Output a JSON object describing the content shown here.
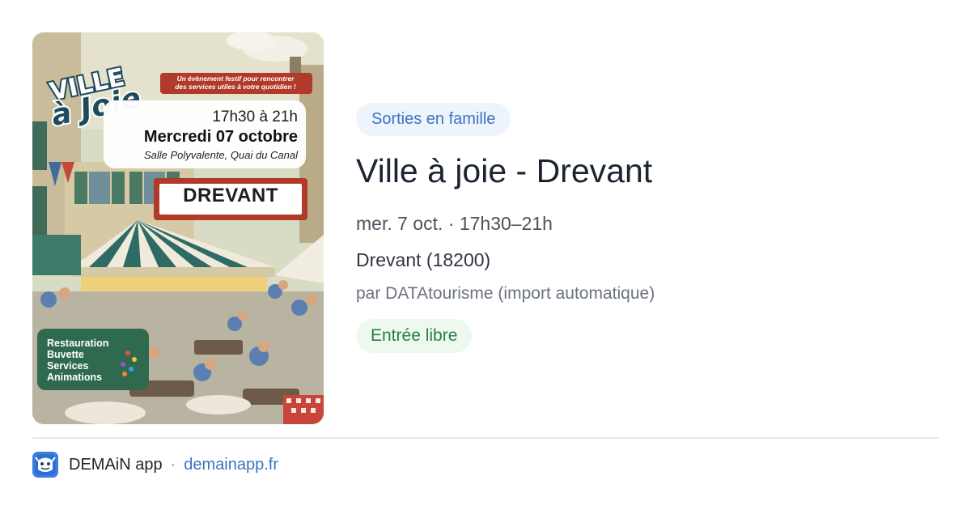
{
  "poster": {
    "brand_line1": "VILLE",
    "brand_line2": "à Joie",
    "tagline_line1": "Un évènement festif pour rencontrer",
    "tagline_line2": "des services utiles à votre quotidien !",
    "time": "17h30 à 21h",
    "date": "Mercredi 07 octobre",
    "venue": "Salle Polyvalente, Quai du Canal",
    "town": "DREVANT",
    "features": [
      "Restauration",
      "Buvette",
      "Services",
      "Animations"
    ]
  },
  "event": {
    "category": "Sorties en famille",
    "title": "Ville à joie - Drevant",
    "datetime": "mer. 7 oct. · 17h30–21h",
    "location": "Drevant (18200)",
    "source": "par DATAtourisme (import automatique)",
    "price": "Entrée libre"
  },
  "footer": {
    "app_name": "DEMAiN app",
    "separator": "·",
    "link": "demainapp.fr",
    "icon": "demain-app-icon"
  },
  "colors": {
    "accent_blue": "#3b74bf",
    "category_bg": "#eef4fc",
    "price_green": "#2c7d45",
    "price_bg": "#edf8ef",
    "poster_badge_red": "#b23a2a",
    "poster_badge_green": "#2f6a4f"
  }
}
